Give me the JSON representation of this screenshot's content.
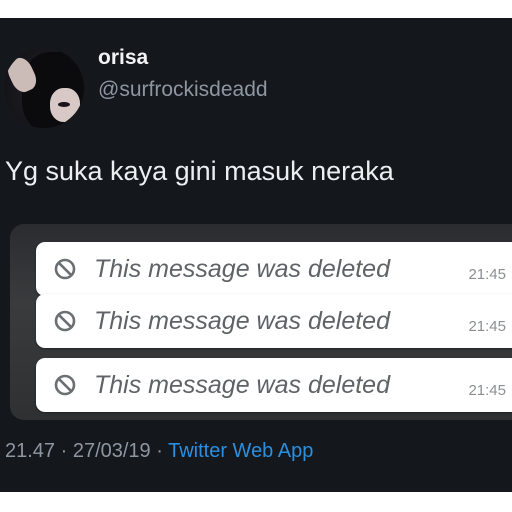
{
  "author": {
    "display_name": "orisa",
    "handle": "@surfrockisdeadd"
  },
  "tweet": {
    "text": "Yg suka kaya gini masuk neraka"
  },
  "media": {
    "messages": [
      {
        "text": "This message was deleted",
        "time": "21:45",
        "icon": "ban-icon"
      },
      {
        "text": "This message was deleted",
        "time": "21:45",
        "icon": "ban-icon"
      },
      {
        "text": "This message was deleted",
        "time": "21:45",
        "icon": "ban-icon"
      }
    ]
  },
  "footer": {
    "timestamp": "21.47 · 27/03/19 · ",
    "source": "Twitter Web App"
  },
  "colors": {
    "background": "#14171c",
    "link": "#2b8fe0",
    "bubble": "#ffffff"
  }
}
